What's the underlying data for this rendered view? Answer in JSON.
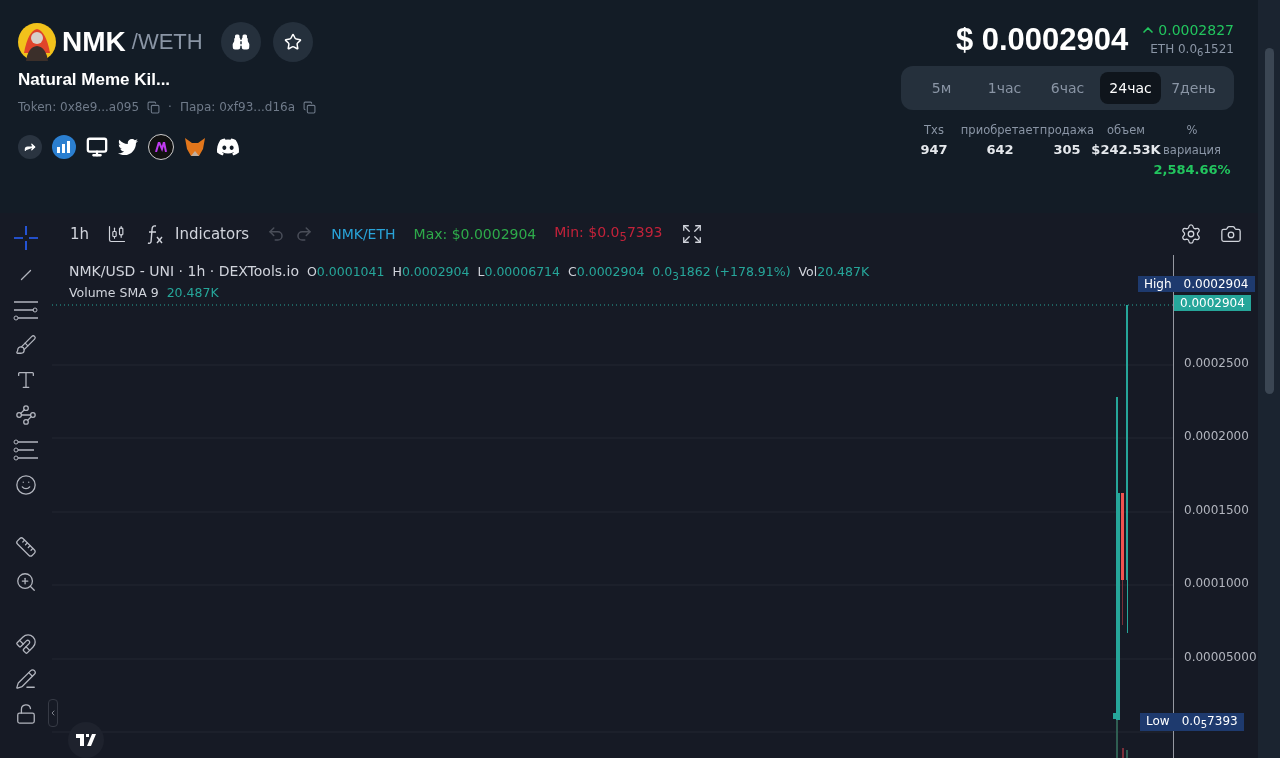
{
  "token": {
    "symbol": "NMK",
    "quote": "/WETH",
    "name": "Natural Meme Kil...",
    "token_address": "Token: 0x8e9...a095",
    "pair_address": "Пара: 0xf93...d16a",
    "separator": "·"
  },
  "price": {
    "usd": "$ 0.0002904",
    "change": "0.0002827",
    "eth": "ETH 0.0$_{6}$1521"
  },
  "timeframes": [
    {
      "label": "5м",
      "selected": false
    },
    {
      "label": "1час",
      "selected": false
    },
    {
      "label": "6час",
      "selected": false
    },
    {
      "label": "24час",
      "selected": true
    },
    {
      "label": "7день",
      "selected": false
    }
  ],
  "stats": [
    {
      "label": "Txs",
      "value": "947"
    },
    {
      "label": "приобретает",
      "value": "642"
    },
    {
      "label": "продажа",
      "value": "305"
    },
    {
      "label": "объем",
      "value": "$242.53K"
    },
    {
      "label": "% вариация",
      "value": "2,584.66%",
      "kind": "change"
    }
  ],
  "toolbar": {
    "interval": "1h",
    "indicators": "Indicators",
    "undo_disabled": true,
    "redo_disabled": true,
    "pair": "NMK/ETH",
    "max": "Max: $0.0002904",
    "min": "Min: $0.0$_{5}$7393"
  },
  "legend": {
    "title": "NMK/USD - UNI · 1h · DEXTools.io",
    "ohlc": [
      {
        "label": "O",
        "value": "0.0001041"
      },
      {
        "label": "H",
        "value": "0.0002904"
      },
      {
        "label": "L",
        "value": "0.00006714"
      },
      {
        "label": "C",
        "value": "0.0002904"
      }
    ],
    "change": "0.0$_{3}$1862 (+178.91%)",
    "vol_label": "Vol",
    "vol_value": "20.487K",
    "sma_label": "Volume SMA 9",
    "sma_value": "20.487K"
  },
  "price_axis": {
    "high_label": "High",
    "high_value": "0.0002904",
    "current": "0.0002904",
    "ticks": [
      "0.0002500",
      "0.0002000",
      "0.0001500",
      "0.0001000",
      "0.00005000"
    ],
    "low_label": "Low",
    "low_value": "0.0$_{5}$7393"
  }
}
